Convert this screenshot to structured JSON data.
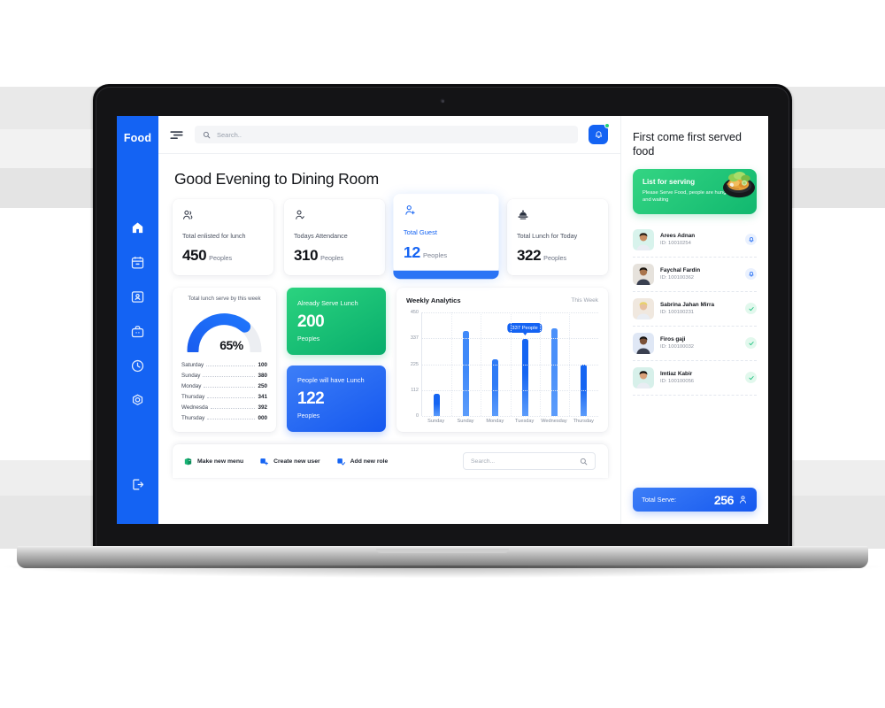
{
  "app": {
    "brand": "Food"
  },
  "topbar": {
    "menu_icon": "hamburger-filter-icon",
    "search_placeholder": "Search..",
    "search_value": "",
    "bell_icon": "notification-bell-icon",
    "has_notification": true
  },
  "sidebar": {
    "items": [
      {
        "icon": "home-icon",
        "name": "home",
        "active": true
      },
      {
        "icon": "calendar-icon",
        "name": "calendar",
        "active": false
      },
      {
        "icon": "id-card-icon",
        "name": "contacts",
        "active": false
      },
      {
        "icon": "briefcase-icon",
        "name": "orders",
        "active": false
      },
      {
        "icon": "clock-icon",
        "name": "history",
        "active": false
      },
      {
        "icon": "gear-icon",
        "name": "settings",
        "active": false
      }
    ],
    "logout": {
      "icon": "logout-icon",
      "name": "logout"
    }
  },
  "main": {
    "greeting": "Good Evening to Dining Room",
    "stats": [
      {
        "icon": "users-group-icon",
        "label": "Total enlisted for lunch",
        "value": "450",
        "unit": "Peoples",
        "active": false
      },
      {
        "icon": "user-check-icon",
        "label": "Todays Attendance",
        "value": "310",
        "unit": "Peoples",
        "active": false
      },
      {
        "icon": "user-add-icon",
        "label": "Total Guest",
        "value": "12",
        "unit": "Peoples",
        "active": true
      },
      {
        "icon": "food-tray-icon",
        "label": "Total Lunch for Today",
        "value": "322",
        "unit": "Peoples",
        "active": false
      }
    ],
    "gauge": {
      "title": "Total lunch serve by this week",
      "percent_label": "65%",
      "percent": 65,
      "rows": [
        {
          "day": "Saturday",
          "value": "100"
        },
        {
          "day": "Sunday",
          "value": "380"
        },
        {
          "day": "Monday",
          "value": "250"
        },
        {
          "day": "Thursday",
          "value": "341"
        },
        {
          "day": "Wednesda",
          "value": "392"
        },
        {
          "day": "Thursday",
          "value": "000"
        }
      ]
    },
    "tiles": [
      {
        "title": "Already Serve Lunch",
        "value": "200",
        "unit": "Peoples",
        "color": "#0ab36c"
      },
      {
        "title": "People will have Lunch",
        "value": "122",
        "unit": "Peoples",
        "color": "#1558ef"
      }
    ],
    "actions": [
      {
        "icon": "menu-board-icon",
        "label": "Make new menu",
        "color": "#18b374"
      },
      {
        "icon": "user-plus-icon",
        "label": "Create new user",
        "color": "#1463f3"
      },
      {
        "icon": "role-check-icon",
        "label": "Add new role",
        "color": "#1463f3"
      }
    ],
    "action_search_placeholder": "Search...",
    "action_search_value": ""
  },
  "chart_data": {
    "type": "bar",
    "title": "Weekly Analytics",
    "subtitle": "This Week",
    "categories": [
      "Sunday",
      "Sunday",
      "Monday",
      "Tuesday",
      "Wednesday",
      "Thursday"
    ],
    "values": [
      95,
      370,
      248,
      335,
      382,
      225
    ],
    "ylabel": "",
    "xlabel": "",
    "ylim": [
      0,
      450
    ],
    "yticks": [
      "450",
      "337",
      "225",
      "112",
      "0"
    ],
    "ytick_values": [
      450,
      337,
      225,
      112,
      0
    ],
    "grid": true,
    "legend": false,
    "annotation": {
      "text": "337  People",
      "category_index": 3,
      "value": 337
    },
    "bar_colors": [
      "#1565f2",
      "#3f89f9",
      "#2f7bf6",
      "#1565f2",
      "#4a90fa",
      "#1565f2"
    ]
  },
  "rightpanel": {
    "title": "First come first served food",
    "serve_card": {
      "title": "List for serving",
      "subtitle": "Please Serve Food, people are hungry and  waiting",
      "image": "food-bowl-icon"
    },
    "people": [
      {
        "name": "Arees Adnan",
        "id": "ID: 10010254",
        "status": "pending",
        "status_icon": "bell-pending-icon",
        "avatar_bg": "#d8f3ec"
      },
      {
        "name": "Faychal Fardin",
        "id": "ID: 100100362",
        "status": "pending",
        "status_icon": "bell-pending-icon",
        "avatar_bg": "#e6e2dc"
      },
      {
        "name": "Sabrina Jahan Mirra",
        "id": "ID: 100100231",
        "status": "done",
        "status_icon": "check-circle-icon",
        "avatar_bg": "#f0e8df"
      },
      {
        "name": "Firos gaji",
        "id": "ID: 100100032",
        "status": "done",
        "status_icon": "check-circle-icon",
        "avatar_bg": "#dfe7f5"
      },
      {
        "name": "Imtiaz Kabir",
        "id": "ID: 100100056",
        "status": "done",
        "status_icon": "check-circle-icon",
        "avatar_bg": "#d7f0ea"
      }
    ],
    "total": {
      "label": "Total Serve:",
      "value": "256",
      "icon": "user-icon"
    }
  },
  "colors": {
    "brand_blue": "#1463f3",
    "green": "#0ab36c",
    "text_dark": "#14171d",
    "muted": "#8b919d"
  }
}
